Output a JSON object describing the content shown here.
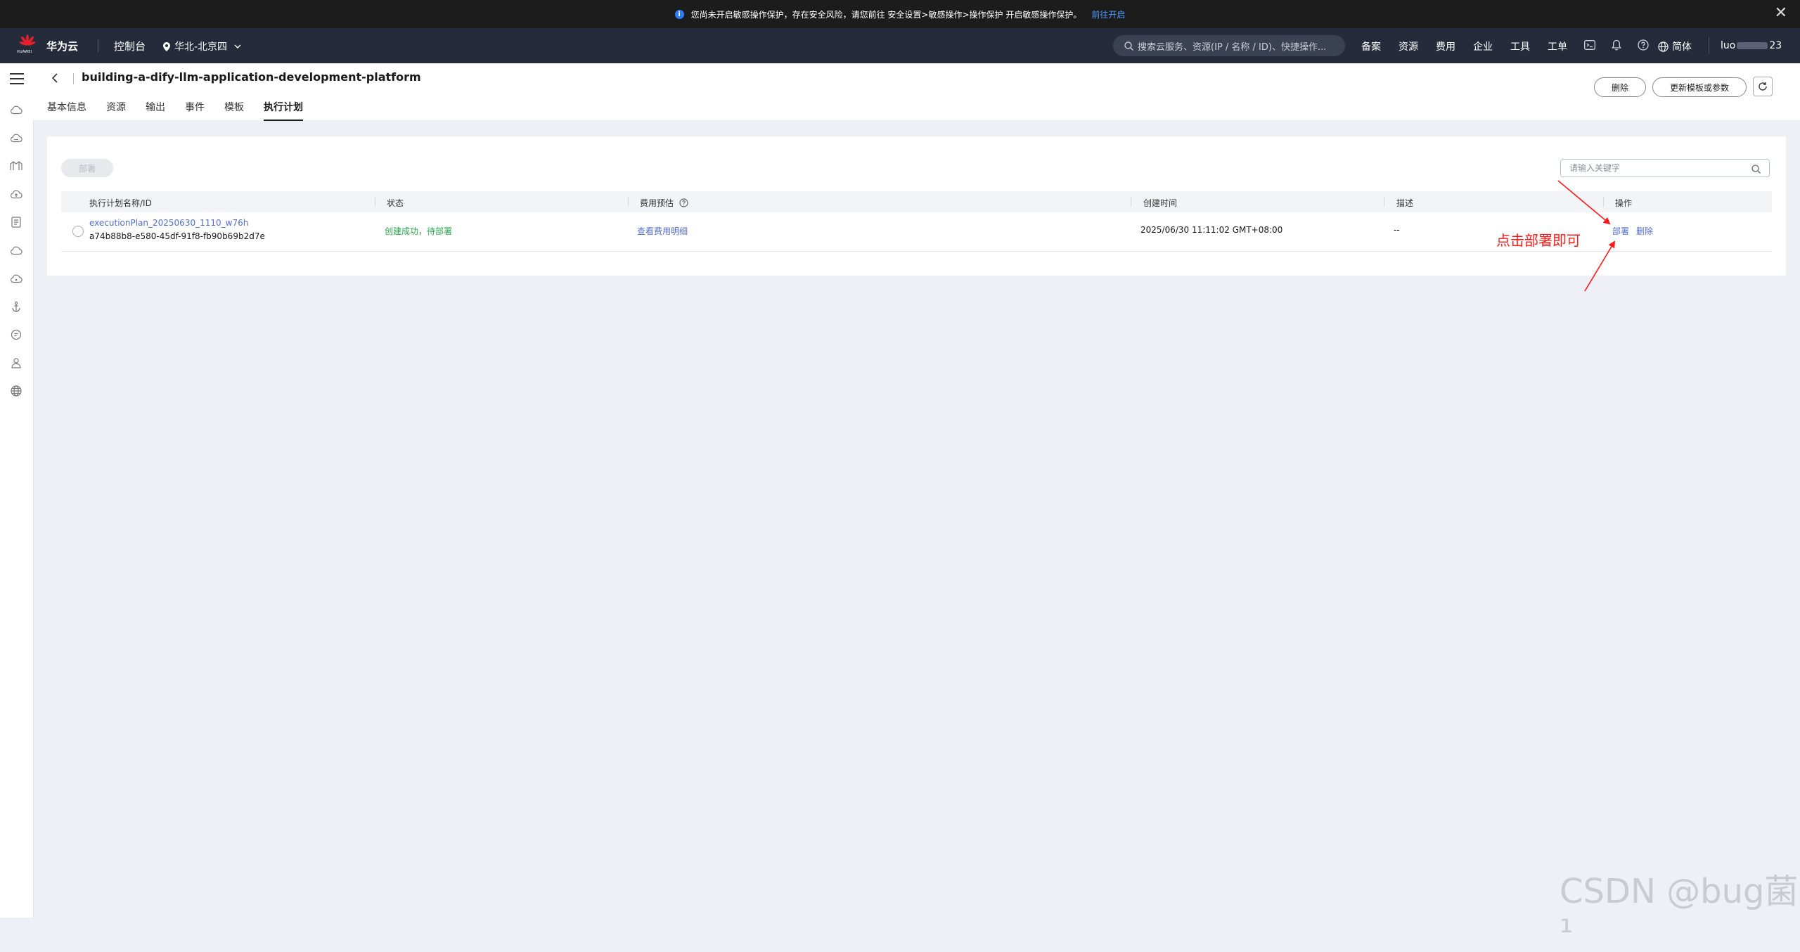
{
  "notice": {
    "info_glyph": "i",
    "text": "您尚未开启敏感操作保护，存在安全风险，请您前往 安全设置>敏感操作>操作保护 开启敏感操作保护。",
    "link": "前往开启",
    "close_glyph": "✕"
  },
  "nav": {
    "logo_word": "HUAWEI",
    "brand": "华为云",
    "console": "控制台",
    "region": "华北-北京四",
    "search_placeholder": "搜索云服务、资源(IP / 名称 / ID)、快捷操作...",
    "links": [
      "备案",
      "资源",
      "费用",
      "企业",
      "工具",
      "工单"
    ],
    "language": "简体",
    "user_prefix": "luo",
    "user_suffix": "23"
  },
  "page": {
    "title": "building-a-dify-llm-application-development-platform",
    "tabs": [
      "基本信息",
      "资源",
      "输出",
      "事件",
      "模板",
      "执行计划"
    ],
    "active_tab": "执行计划",
    "delete_btn": "删除",
    "update_btn": "更新模板或参数"
  },
  "table": {
    "deploy_btn": "部署",
    "search_placeholder": "请输入关键字",
    "headers": {
      "name": "执行计划名称/ID",
      "status": "状态",
      "fee": "费用预估",
      "created": "创建时间",
      "desc": "描述",
      "actions": "操作"
    },
    "rows": [
      {
        "name": "executionPlan_20250630_1110_w76h",
        "id": "a74b88b8-e580-45df-91f8-fb90b69b2d7e",
        "status": "创建成功，待部署",
        "fee": "查看费用明细",
        "created": "2025/06/30 11:11:02 GMT+08:00",
        "desc": "--",
        "action_deploy": "部署",
        "action_delete": "删除"
      }
    ]
  },
  "annotation": "点击部署即可",
  "watermark": "CSDN @bug菌¹",
  "colors": {
    "nav_bg": "#252b3a",
    "notice_bg": "#1c1c1c",
    "link_blue": "#526ecc",
    "status_green": "#2aa44b",
    "annotation_red": "#ff1a1a"
  }
}
